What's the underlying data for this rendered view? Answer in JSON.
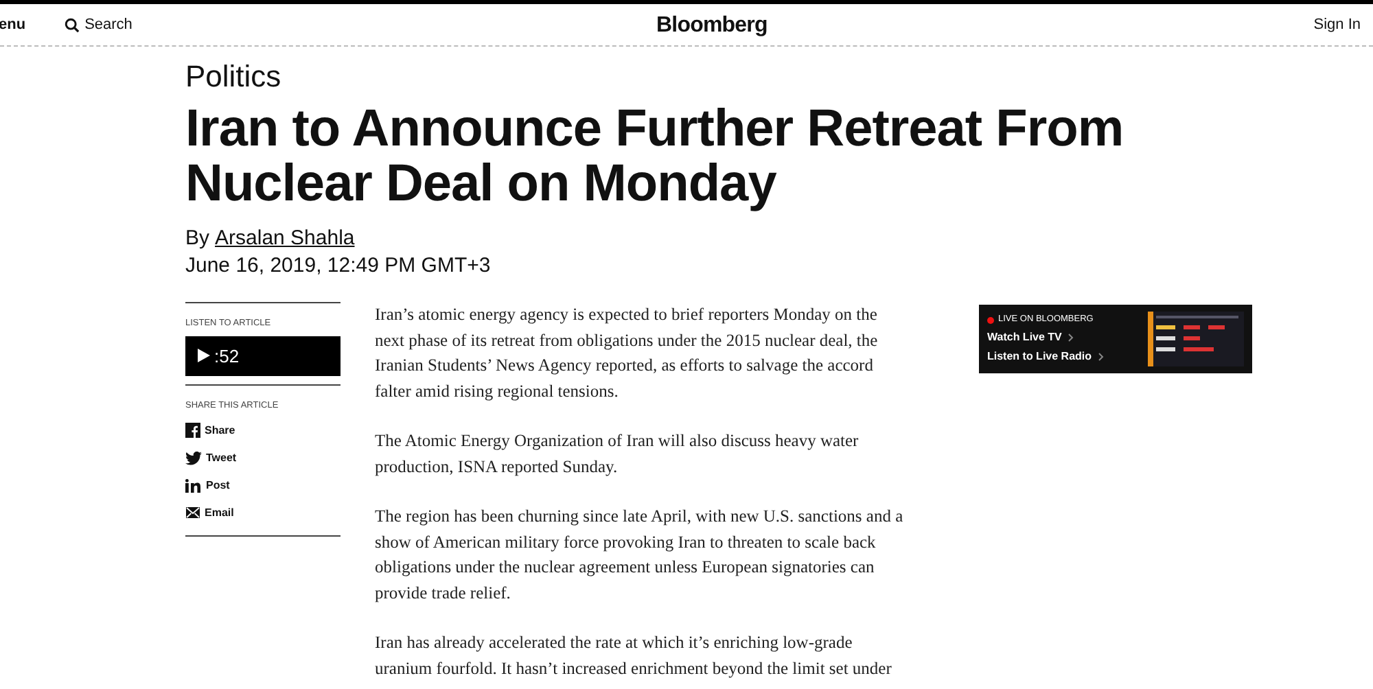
{
  "header": {
    "menu": "enu",
    "search": "Search",
    "logo": "Bloomberg",
    "sign_in": "Sign In"
  },
  "article": {
    "section": "Politics",
    "headline": "Iran to Announce Further Retreat From Nuclear Deal on Monday",
    "byline_prefix": "By",
    "author": "Arsalan Shahla",
    "date": "June 16, 2019, 12:49 PM GMT+3",
    "listen": {
      "label": "LISTEN TO ARTICLE",
      "duration": ":52"
    },
    "share": {
      "label": "SHARE THIS ARTICLE",
      "items": [
        {
          "kind": "facebook",
          "label": "Share"
        },
        {
          "kind": "twitter",
          "label": "Tweet"
        },
        {
          "kind": "linkedin",
          "label": "Post"
        },
        {
          "kind": "email",
          "label": "Email"
        }
      ]
    },
    "paragraphs": [
      [
        "Iran’s atomic energy agency is expected to brief reporters Monday on the",
        "next phase of its retreat from obligations under the 2015 nuclear deal, the",
        "Iranian Students’ News Agency reported, as efforts to salvage the accord",
        "falter amid rising regional tensions."
      ],
      [
        "The Atomic Energy Organization of Iran will also discuss heavy water",
        "production, ISNA reported Sunday."
      ],
      [
        "The region has been churning since late April, with new U.S. sanctions and a",
        "show of American military force provoking Iran to threaten to scale back",
        "obligations under the nuclear agreement unless European signatories can",
        "provide trade relief."
      ],
      [
        "Iran has already accelerated the rate at which it’s enriching low-grade",
        "uranium fourfold. It hasn’t increased enrichment beyond the limit set under"
      ]
    ]
  },
  "live": {
    "label": "LIVE ON BLOOMBERG",
    "links": [
      "Watch Live TV",
      "Listen to Live Radio"
    ]
  }
}
